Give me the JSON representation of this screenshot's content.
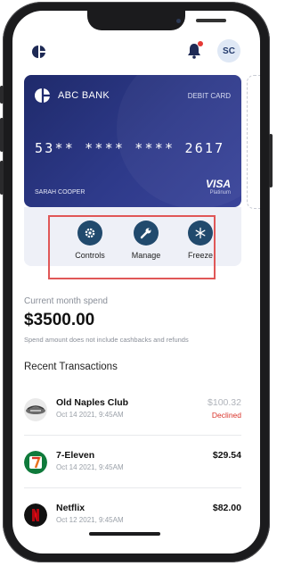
{
  "header": {
    "avatar_initials": "SC",
    "notification_dot_color": "#e53935"
  },
  "card": {
    "bank_name": "ABC BANK",
    "type": "DEBIT CARD",
    "number": "53** **** **** 2617",
    "holder": "SARAH COOPER",
    "network": "VISA",
    "tier": "Platinum"
  },
  "controls": [
    {
      "label": "Controls",
      "icon": "gear-icon"
    },
    {
      "label": "Manage",
      "icon": "wrench-icon"
    },
    {
      "label": "Freeze",
      "icon": "snowflake-icon"
    }
  ],
  "spend": {
    "caption": "Current month spend",
    "amount": "$3500.00",
    "note": "Spend amount does not include cashbacks and refunds"
  },
  "recent_title": "Recent Transactions",
  "transactions": [
    {
      "merchant": "Old Naples Club",
      "date": "Oct 14 2021, 9:45AM",
      "amount": "$100.32",
      "status": "Declined"
    },
    {
      "merchant": "7-Eleven",
      "date": "Oct 14 2021, 9:45AM",
      "amount": "$29.54",
      "status": ""
    },
    {
      "merchant": "Netflix",
      "date": "Oct 12 2021, 9:45AM",
      "amount": "$82.00",
      "status": ""
    }
  ],
  "colors": {
    "brand": "#214a6d",
    "card_dark": "#1f2a6b",
    "declined": "#d9342b",
    "highlight": "#e05757"
  }
}
